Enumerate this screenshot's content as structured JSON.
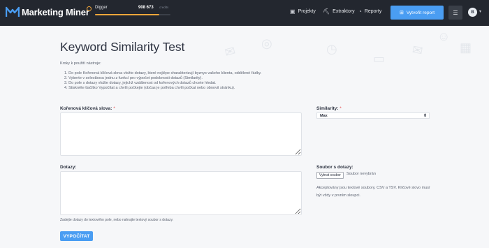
{
  "brand": {
    "name": "Marketing Miner"
  },
  "credit": {
    "plan": "Digger",
    "value": "908 673",
    "unit": "credits",
    "progress": 0.85
  },
  "nav": {
    "projekty": "Projekty",
    "extraktory": "Extraktory",
    "reporty": "Reporty",
    "create_report": "Vytvořit report",
    "menu_icon": "hamburger-icon",
    "avatar_initial": "B"
  },
  "page": {
    "title": "Keyword Similarity Test",
    "intro": "Kroky k použití nástroje:",
    "steps": [
      "Do pole Kořenová klíčová slova vložte dotazy, které nejlépe charakterizují byznys vašeho klienta, oddělené řádky.",
      "Vyberte v selectboxu jednu z funkcí pro výpočet podobnosti dotazů (Similarity).",
      "Do pole s dotazy vložte dotazy, jejichž vzdálenost od kořenových dotazů chcete hledat.",
      "Stiskněte tlačítko Vypočítat a chvíli počkejte (občas je potřeba chvíli počkat nebo obnovit stránku)."
    ]
  },
  "form": {
    "root_label": "Kořenová klíčová slova:",
    "required_mark": "*",
    "dotazy_label": "Dotazy:",
    "similarity_label": "Similarity:",
    "similarity_value": "Max",
    "file_label": "Soubor s dotazy:",
    "file_button": "Vybrat soubor",
    "file_status": "Soubor nevybrán",
    "file_note": "Akceptovány jsou textové soubory, CSV a TSV. Klíčové slovo musí být vždy v prvním sloupci.",
    "hint": "Zadejte dotazy do textového pole, nebo nahrajte textový soubor s dotazy.",
    "submit": "VYPOČÍTAT"
  },
  "colors": {
    "navbar": "#23272f",
    "accent": "#4a9df2",
    "credit": "#f2a63a",
    "required": "#e64c4c"
  }
}
